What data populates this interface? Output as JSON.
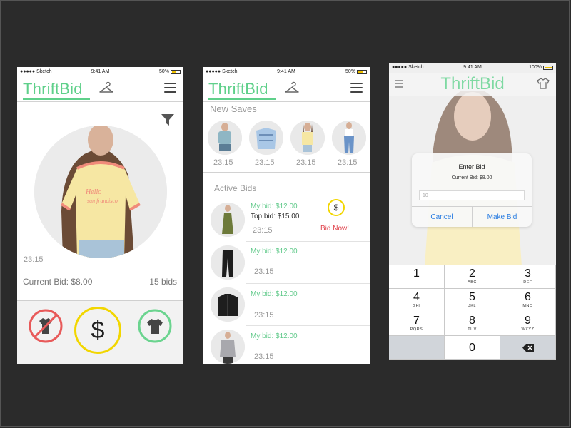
{
  "statusbar": {
    "carrier": "●●●●● Sketch",
    "time": "9:41 AM",
    "battery_p1": "50%",
    "battery_p2": "50%",
    "battery_p3": "100%"
  },
  "brand": "ThriftBid",
  "screen1": {
    "timestamp": "23:15",
    "current_bid": "Current Bid: $8.00",
    "bid_count": "15 bids",
    "bid_symbol": "$"
  },
  "screen2": {
    "new_saves_title": "New Saves",
    "saves": [
      {
        "time": "23:15"
      },
      {
        "time": "23:15"
      },
      {
        "time": "23:15"
      },
      {
        "time": "23:15"
      }
    ],
    "active_bids_title": "Active Bids",
    "bids": [
      {
        "my_bid": "My bid: $12.00",
        "top_bid": "Top bid: $15.00",
        "time": "23:15"
      },
      {
        "my_bid": "My bid: $12.00",
        "time": "23:15"
      },
      {
        "my_bid": "My bid: $12.00",
        "time": "23:15"
      },
      {
        "my_bid": "My bid: $12.00",
        "time": "23:15"
      }
    ],
    "bid_now": "Bid Now!",
    "bid_symbol": "$"
  },
  "screen3": {
    "dialog_title": "Enter Bid",
    "dialog_current": "Current Bid: $8.00",
    "input_value": "10",
    "cancel": "Cancel",
    "make_bid": "Make Bid",
    "keys": [
      {
        "n": "1",
        "s": ""
      },
      {
        "n": "2",
        "s": "ABC"
      },
      {
        "n": "3",
        "s": "DEF"
      },
      {
        "n": "4",
        "s": "GHI"
      },
      {
        "n": "5",
        "s": "JKL"
      },
      {
        "n": "6",
        "s": "MNO"
      },
      {
        "n": "7",
        "s": "PQRS"
      },
      {
        "n": "8",
        "s": "TUV"
      },
      {
        "n": "9",
        "s": "WXYZ"
      },
      {
        "n": "0",
        "s": ""
      }
    ]
  },
  "colors": {
    "brand": "#5fd08a",
    "reject": "#e85a5a",
    "bid": "#f2d600",
    "accept": "#6bd48f",
    "bid_now": "#e0414a",
    "ios_blue": "#2a7de1"
  }
}
